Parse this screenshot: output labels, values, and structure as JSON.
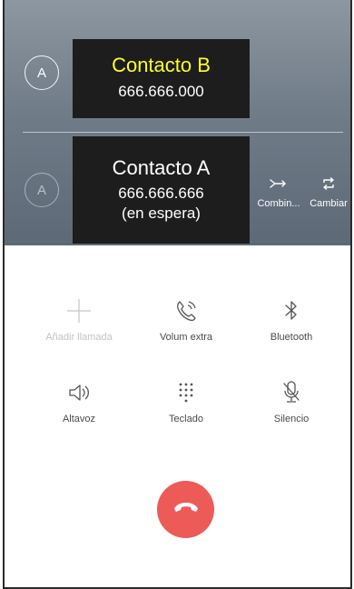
{
  "active_call": {
    "avatar_initial": "A",
    "name": "Contacto B",
    "number": "666.666.000"
  },
  "held_call": {
    "avatar_initial": "A",
    "name": "Contacto A",
    "number": "666.666.666",
    "status": "(en espera)"
  },
  "call_actions": {
    "merge_label": "Combin...",
    "swap_label": "Cambiar"
  },
  "controls": {
    "add_call": "Añadir llamada",
    "extra_volume": "Volum extra",
    "bluetooth": "Bluetooth",
    "speaker": "Altavoz",
    "keypad": "Teclado",
    "mute": "Silencio"
  },
  "colors": {
    "header_top": "#8d97a1",
    "header_bottom": "#5d6976",
    "active_name": "#ffff24",
    "end_call": "#ec5b57"
  },
  "icons": {
    "add_call": "plus-icon",
    "extra_volume": "phone-volume-icon",
    "bluetooth": "bluetooth-icon",
    "speaker": "speaker-icon",
    "keypad": "keypad-icon",
    "mute": "mic-off-icon",
    "merge": "merge-arrow-icon",
    "swap": "swap-icon",
    "end_call": "phone-hangup-icon"
  }
}
